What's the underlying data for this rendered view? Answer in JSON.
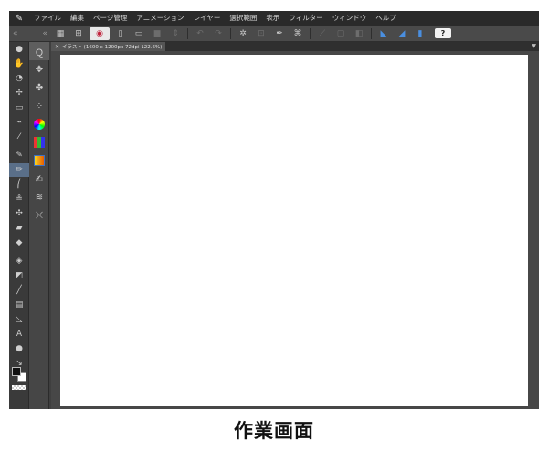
{
  "menubar": {
    "logo_icon": "brush-logo-icon",
    "items": [
      "ファイル",
      "編集",
      "ページ管理",
      "アニメーション",
      "レイヤー",
      "選択範囲",
      "表示",
      "フィルター",
      "ウィンドウ",
      "ヘルプ"
    ]
  },
  "toolbar": {
    "collapse_left": "«",
    "collapse_right": "«",
    "help_label": "?"
  },
  "tab": {
    "label": "イラスト (1600 x 1200px 72dpi 122.6%)"
  },
  "tools": {
    "text_tool_label": "A"
  },
  "colors": {
    "main": "#111111",
    "sub": "#ffffff",
    "accent": "#5a6f89"
  },
  "caption": "作業画面"
}
